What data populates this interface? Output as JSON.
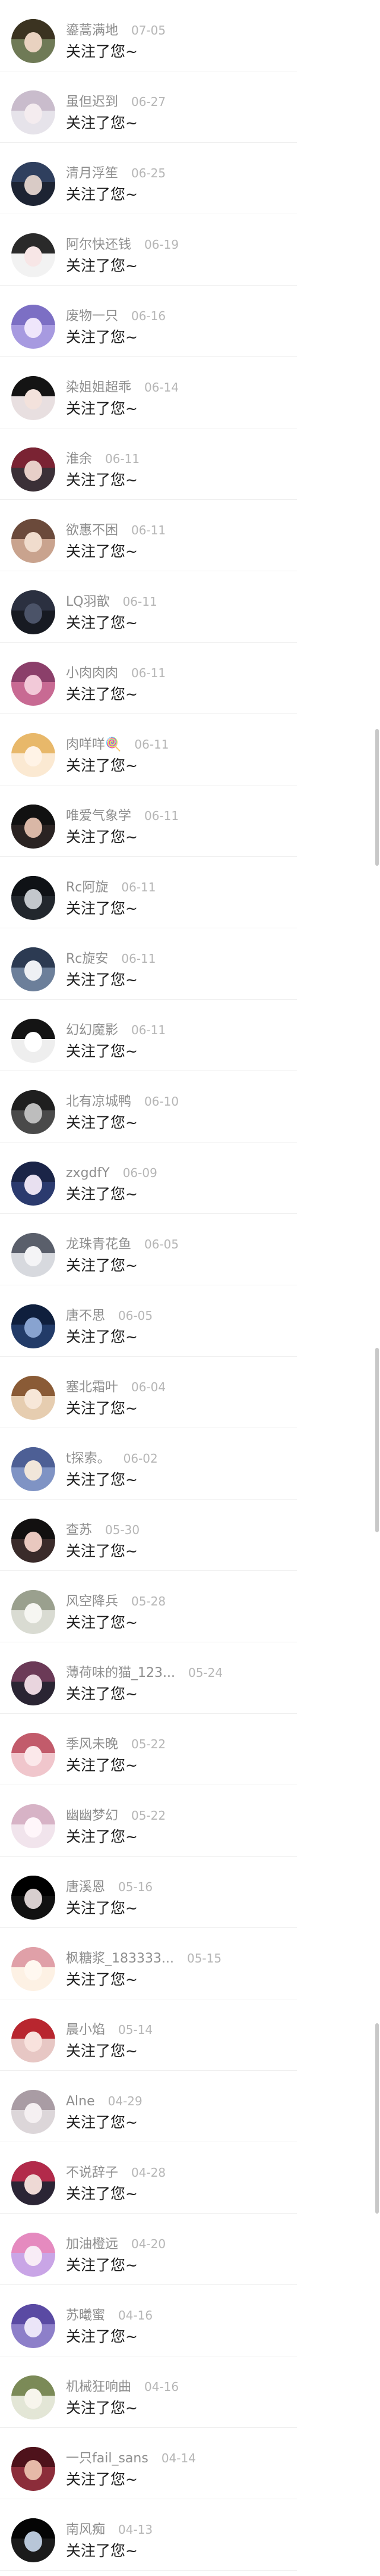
{
  "follow_message": "关注了您~",
  "items": [
    {
      "name": "鎏蒿满地",
      "date": "07-05",
      "avatar_bg": "#6f7a56",
      "avatar_hair": "#3b3321",
      "avatar_face": "#e9d2c0"
    },
    {
      "name": "虽但迟到",
      "date": "06-27",
      "avatar_bg": "#e6e3ea",
      "avatar_hair": "#c9bccc",
      "avatar_face": "#f4ecef"
    },
    {
      "name": "清月浮笙",
      "date": "06-25",
      "avatar_bg": "#1d2433",
      "avatar_hair": "#2f3f5e",
      "avatar_face": "#d9cbc6"
    },
    {
      "name": "阿尔快还钱",
      "date": "06-19",
      "avatar_bg": "#f2f2f2",
      "avatar_hair": "#2a2a2a",
      "avatar_face": "#f7e6e6"
    },
    {
      "name": "废物一只",
      "date": "06-16",
      "avatar_bg": "#a79ae0",
      "avatar_hair": "#7c6fc4",
      "avatar_face": "#efe6fb"
    },
    {
      "name": "染姐姐超乖",
      "date": "06-14",
      "avatar_bg": "#e8dfe0",
      "avatar_hair": "#141414",
      "avatar_face": "#f3e2dc"
    },
    {
      "name": "淮余",
      "date": "06-11",
      "avatar_bg": "#3b3037",
      "avatar_hair": "#7a2333",
      "avatar_face": "#e7cfc8"
    },
    {
      "name": "欲惠不困",
      "date": "06-11",
      "avatar_bg": "#c9a38e",
      "avatar_hair": "#6b4a3b",
      "avatar_face": "#f0dccd"
    },
    {
      "name": "LQ羽歆",
      "date": "06-11",
      "avatar_bg": "#171a22",
      "avatar_hair": "#2b3040",
      "avatar_face": "#4b5368"
    },
    {
      "name": "小肉肉肉",
      "date": "06-11",
      "avatar_bg": "#c86a93",
      "avatar_hair": "#8b3f6a",
      "avatar_face": "#f2c9d8"
    },
    {
      "name": "肉咩咩🍭",
      "date": "06-11",
      "avatar_bg": "#fbe9d2",
      "avatar_hair": "#e8b86a",
      "avatar_face": "#fff3e6"
    },
    {
      "name": "唯爱气象学",
      "date": "06-11",
      "avatar_bg": "#2a2322",
      "avatar_hair": "#111111",
      "avatar_face": "#d9b7a6"
    },
    {
      "name": "Rc阿旋",
      "date": "06-11",
      "avatar_bg": "#22272d",
      "avatar_hair": "#0f1216",
      "avatar_face": "#c3c7cc"
    },
    {
      "name": "Rc旋安",
      "date": "06-11",
      "avatar_bg": "#6c7f9a",
      "avatar_hair": "#2c3a52",
      "avatar_face": "#eef0f4"
    },
    {
      "name": "幻幻魔影",
      "date": "06-11",
      "avatar_bg": "#eeeeee",
      "avatar_hair": "#141414",
      "avatar_face": "#ffffff"
    },
    {
      "name": "北有凉城鸭",
      "date": "06-10",
      "avatar_bg": "#4a4a4a",
      "avatar_hair": "#1f1f1f",
      "avatar_face": "#bdbdbd"
    },
    {
      "name": "zxgdfY",
      "date": "06-09",
      "avatar_bg": "#2b3a6e",
      "avatar_hair": "#1a2447",
      "avatar_face": "#e8e0f0"
    },
    {
      "name": "龙珠青花鱼",
      "date": "06-05",
      "avatar_bg": "#d7d9de",
      "avatar_hair": "#5a5f6b",
      "avatar_face": "#f4f4f6"
    },
    {
      "name": "唐不思",
      "date": "06-05",
      "avatar_bg": "#223b68",
      "avatar_hair": "#0f1f3d",
      "avatar_face": "#88a3d0"
    },
    {
      "name": "塞北霜叶",
      "date": "06-04",
      "avatar_bg": "#e6cdb0",
      "avatar_hair": "#8a5b36",
      "avatar_face": "#f7e7d8"
    },
    {
      "name": "t探索。",
      "date": "06-02",
      "avatar_bg": "#7f93c4",
      "avatar_hair": "#4d5f95",
      "avatar_face": "#f1e6da"
    },
    {
      "name": "查苏",
      "date": "05-30",
      "avatar_bg": "#3a2b2a",
      "avatar_hair": "#121010",
      "avatar_face": "#e9c8bf"
    },
    {
      "name": "风空降兵",
      "date": "05-28",
      "avatar_bg": "#d9dbd2",
      "avatar_hair": "#9aa08e",
      "avatar_face": "#f6f6f2"
    },
    {
      "name": "薄荷味的猫_123...",
      "date": "05-24",
      "avatar_bg": "#2a2533",
      "avatar_hair": "#6b3a57",
      "avatar_face": "#e9d5de"
    },
    {
      "name": "季风未晚",
      "date": "05-22",
      "avatar_bg": "#f0c6cc",
      "avatar_hair": "#c25b6b",
      "avatar_face": "#fbe8ea"
    },
    {
      "name": "幽幽梦幻",
      "date": "05-22",
      "avatar_bg": "#f1e4ec",
      "avatar_hair": "#d7b3c6",
      "avatar_face": "#fff6fa"
    },
    {
      "name": "唐溪恩",
      "date": "05-16",
      "avatar_bg": "#111111",
      "avatar_hair": "#000000",
      "avatar_face": "#d8cfcf"
    },
    {
      "name": "枫糖浆_183333...",
      "date": "05-15",
      "avatar_bg": "#fdf1e4",
      "avatar_hair": "#e0a0a8",
      "avatar_face": "#fff8f0"
    },
    {
      "name": "晨小焰",
      "date": "05-14",
      "avatar_bg": "#e7c7c4",
      "avatar_hair": "#b8262f",
      "avatar_face": "#f8e2dd"
    },
    {
      "name": "Alne",
      "date": "04-29",
      "avatar_bg": "#dcd6d9",
      "avatar_hair": "#a99ca4",
      "avatar_face": "#f5f0f2"
    },
    {
      "name": "不说辞子",
      "date": "04-28",
      "avatar_bg": "#2b2535",
      "avatar_hair": "#b22a4a",
      "avatar_face": "#eed9d5"
    },
    {
      "name": "加油橙远",
      "date": "04-20",
      "avatar_bg": "#c9a5e6",
      "avatar_hair": "#e58abf",
      "avatar_face": "#f8ecf6"
    },
    {
      "name": "苏曦蜜",
      "date": "04-16",
      "avatar_bg": "#8d7fc9",
      "avatar_hair": "#5a4aa3",
      "avatar_face": "#ebe5f8"
    },
    {
      "name": "机械狂响曲",
      "date": "04-16",
      "avatar_bg": "#e3e6d6",
      "avatar_hair": "#7b8a57",
      "avatar_face": "#f7f5ec"
    },
    {
      "name": "一只fail_sans",
      "date": "04-14",
      "avatar_bg": "#8c2d3a",
      "avatar_hair": "#4e121b",
      "avatar_face": "#e6b9a8"
    },
    {
      "name": "南风痴",
      "date": "04-13",
      "avatar_bg": "#1b1b1b",
      "avatar_hair": "#050505",
      "avatar_face": "#b8c6d8"
    }
  ]
}
